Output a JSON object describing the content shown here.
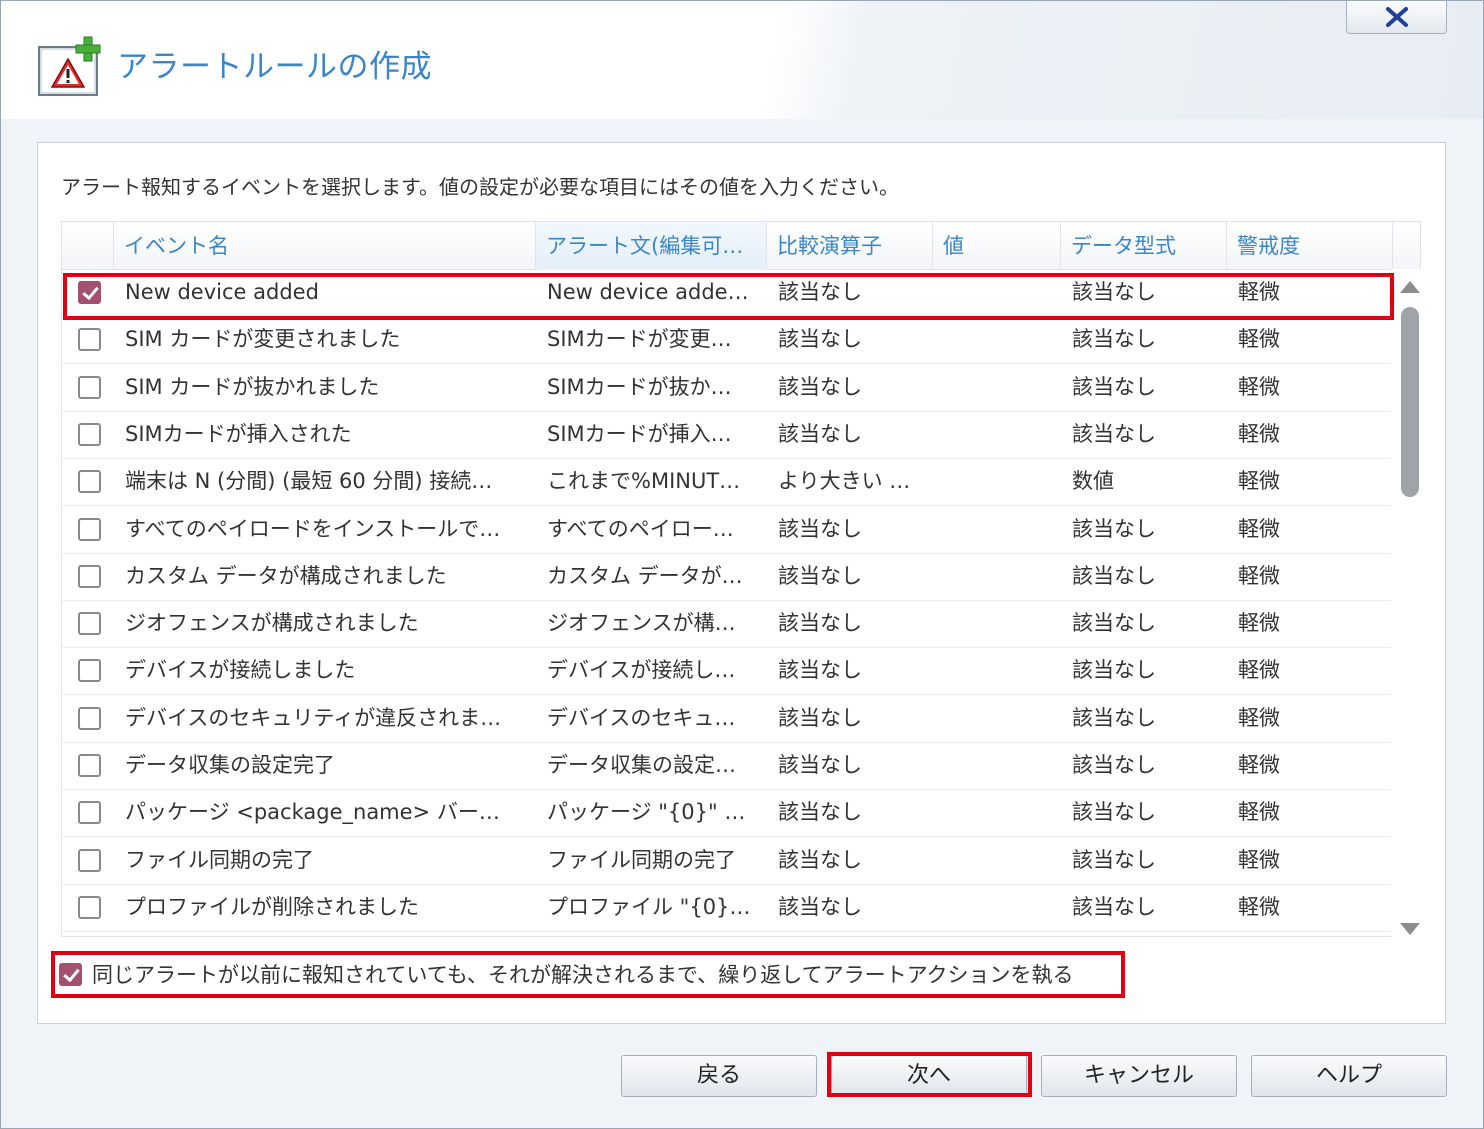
{
  "window": {
    "title": "アラートルールの作成",
    "close_icon": "close-icon",
    "title_icon": "alert-add-icon"
  },
  "instruction": "アラート報知するイベントを選択します。値の設定が必要な項目にはその値を入力ください。",
  "table": {
    "columns": [
      "イベント名",
      "アラート文(編集可…",
      "比較演算子",
      "値",
      "データ型式",
      "警戒度"
    ],
    "rows": [
      {
        "checked": true,
        "event": "New device added",
        "alert": "New device adde…",
        "op": "該当なし",
        "value": "",
        "type": "該当なし",
        "severity": "軽微"
      },
      {
        "checked": false,
        "event": "SIM カードが変更されました",
        "alert": "SIMカードが変更…",
        "op": "該当なし",
        "value": "",
        "type": "該当なし",
        "severity": "軽微"
      },
      {
        "checked": false,
        "event": "SIM カードが抜かれました",
        "alert": "SIMカードが抜か…",
        "op": "該当なし",
        "value": "",
        "type": "該当なし",
        "severity": "軽微"
      },
      {
        "checked": false,
        "event": "SIMカードが挿入された",
        "alert": "SIMカードが挿入…",
        "op": "該当なし",
        "value": "",
        "type": "該当なし",
        "severity": "軽微"
      },
      {
        "checked": false,
        "event": "端末は N (分間) (最短 60 分間) 接続…",
        "alert": "これまで%MINUT…",
        "op": "より大きい …",
        "value": "",
        "type": "数値",
        "severity": "軽微"
      },
      {
        "checked": false,
        "event": "すべてのペイロードをインストールで…",
        "alert": "すべてのペイロー…",
        "op": "該当なし",
        "value": "",
        "type": "該当なし",
        "severity": "軽微"
      },
      {
        "checked": false,
        "event": "カスタム データが構成されました",
        "alert": "カスタム データが…",
        "op": "該当なし",
        "value": "",
        "type": "該当なし",
        "severity": "軽微"
      },
      {
        "checked": false,
        "event": "ジオフェンスが構成されました",
        "alert": "ジオフェンスが構…",
        "op": "該当なし",
        "value": "",
        "type": "該当なし",
        "severity": "軽微"
      },
      {
        "checked": false,
        "event": "デバイスが接続しました",
        "alert": "デバイスが接続し…",
        "op": "該当なし",
        "value": "",
        "type": "該当なし",
        "severity": "軽微"
      },
      {
        "checked": false,
        "event": "デバイスのセキュリティが違反されま…",
        "alert": "デバイスのセキュ…",
        "op": "該当なし",
        "value": "",
        "type": "該当なし",
        "severity": "軽微"
      },
      {
        "checked": false,
        "event": "データ収集の設定完了",
        "alert": "データ収集の設定…",
        "op": "該当なし",
        "value": "",
        "type": "該当なし",
        "severity": "軽微"
      },
      {
        "checked": false,
        "event": "パッケージ <package_name> バー…",
        "alert": "パッケージ \"{0}\" …",
        "op": "該当なし",
        "value": "",
        "type": "該当なし",
        "severity": "軽微"
      },
      {
        "checked": false,
        "event": "ファイル同期の完了",
        "alert": "ファイル同期の完了",
        "op": "該当なし",
        "value": "",
        "type": "該当なし",
        "severity": "軽微"
      },
      {
        "checked": false,
        "event": "プロファイルが削除されました",
        "alert": "プロファイル \"{0}…",
        "op": "該当なし",
        "value": "",
        "type": "該当なし",
        "severity": "軽微"
      }
    ]
  },
  "repeat_option": {
    "checked": true,
    "label": "同じアラートが以前に報知されていても、それが解決されるまで、繰り返してアラートアクションを執る"
  },
  "buttons": {
    "back": "戻る",
    "next": "次へ",
    "cancel": "キャンセル",
    "help": "ヘルプ"
  },
  "colors": {
    "accent": "#3a86c8",
    "checkbox": "#a3516f",
    "highlight": "#e00012"
  }
}
